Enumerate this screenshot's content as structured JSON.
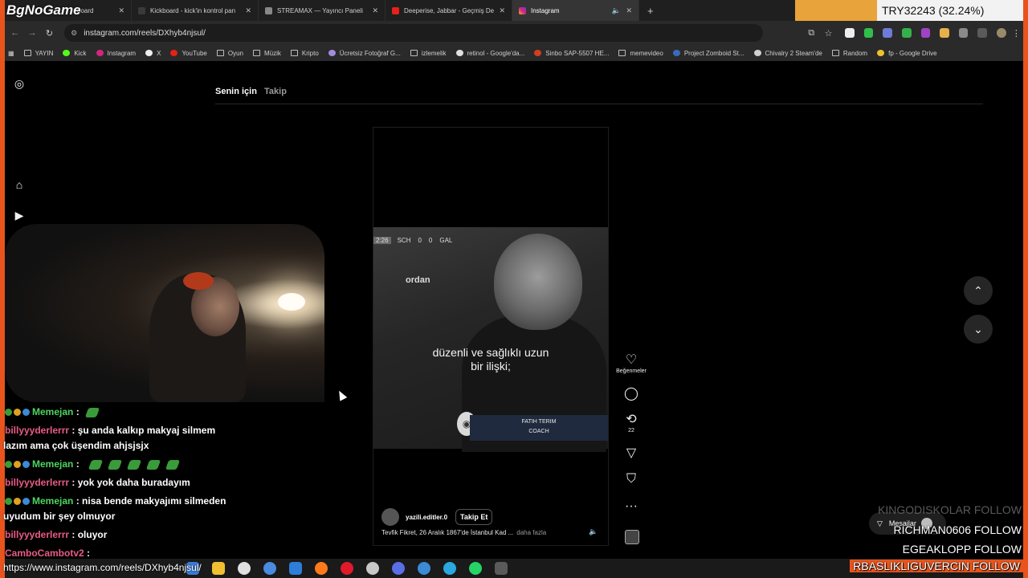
{
  "stream_overlay": {
    "logo": "BgNoGame",
    "score": "TRY32243 (32.24%)"
  },
  "browser": {
    "tabs": [
      {
        "label": "board",
        "active": false
      },
      {
        "label": "Kickboard - kick'in kontrol pan",
        "active": false
      },
      {
        "label": "STREAMAX — Yayıncı Paneli",
        "active": false
      },
      {
        "label": "Deeperise, Jabbar - Geçmiş De",
        "active": false
      },
      {
        "label": "Instagram",
        "active": true
      }
    ],
    "url": "instagram.com/reels/DXhyb4njsul/",
    "bookmarks": [
      "YAYIN",
      "Kick",
      "Instagram",
      "X",
      "YouTube",
      "Oyun",
      "Müzik",
      "Kripto",
      "Ücretsiz Fotoğraf G...",
      "izlemelik",
      "retinol - Google'da...",
      "Sinbo SAP-5507 HE...",
      "memevideo",
      "Project Zomboid St...",
      "Chivalry 2 Steam'de",
      "Random",
      "fp - Google Drive"
    ]
  },
  "instagram": {
    "feed_tabs": {
      "for_you": "Senin için",
      "following": "Takip"
    },
    "reel": {
      "score_bug": {
        "time": "2:26",
        "home": "SCH",
        "home_score": "0",
        "away_score": "0",
        "away": "GAL"
      },
      "overlay_word": "ordan",
      "subtitle_line1": "düzenli ve sağlıklı uzun",
      "subtitle_line2": "bir ilişki;",
      "lower_third_name": "FATIH TERIM",
      "lower_third_role": "COACH",
      "username": "yazili.editler.0",
      "follow_label": "Takip Et",
      "caption": "Tevfik Fikret, 26 Aralık 1867'de İstanbul Kad ...",
      "caption_more": "daha fazla"
    },
    "actions": {
      "likes_label": "Beğenmeler",
      "repost_count": "22"
    },
    "messages_label": "Mesajlar"
  },
  "chat": [
    {
      "user": "Memejan",
      "text": "",
      "color": "#4dd65f",
      "badges": true,
      "emotes": 1
    },
    {
      "user": "billyyyderlerrr",
      "text": "şu anda kalkıp makyaj silmem",
      "cont": "lazım ama çok üşendim ahjsjsjx",
      "color": "#ea5b86"
    },
    {
      "user": "Memejan",
      "text": "",
      "color": "#4dd65f",
      "badges": true,
      "emotes": 6
    },
    {
      "user": "billyyyderlerrr",
      "text": "yok yok daha buradayım",
      "color": "#ea5b86"
    },
    {
      "user": "Memejan",
      "text": "nisa bende makyajımı silmeden",
      "cont": "uyudum bir şey olmuyor",
      "color": "#4dd65f",
      "badges": true
    },
    {
      "user": "billyyyderlerrr",
      "text": "oluyor",
      "color": "#ea5b86"
    },
    {
      "user": "CamboCambotv2",
      "text": "",
      "color": "#ea5b86"
    }
  ],
  "follows": [
    {
      "name": "KINGODISKOLAR",
      "label": "FOLLOW"
    },
    {
      "name": "RICHMAN0606",
      "label": "FOLLOW"
    },
    {
      "name": "EGEAKLOPP",
      "label": "FOLLOW"
    },
    {
      "name": "RBASLIKLIGUVERCIN",
      "label": "FOLLOW"
    }
  ],
  "status_url": "https://www.instagram.com/reels/DXhyb4njsul/"
}
